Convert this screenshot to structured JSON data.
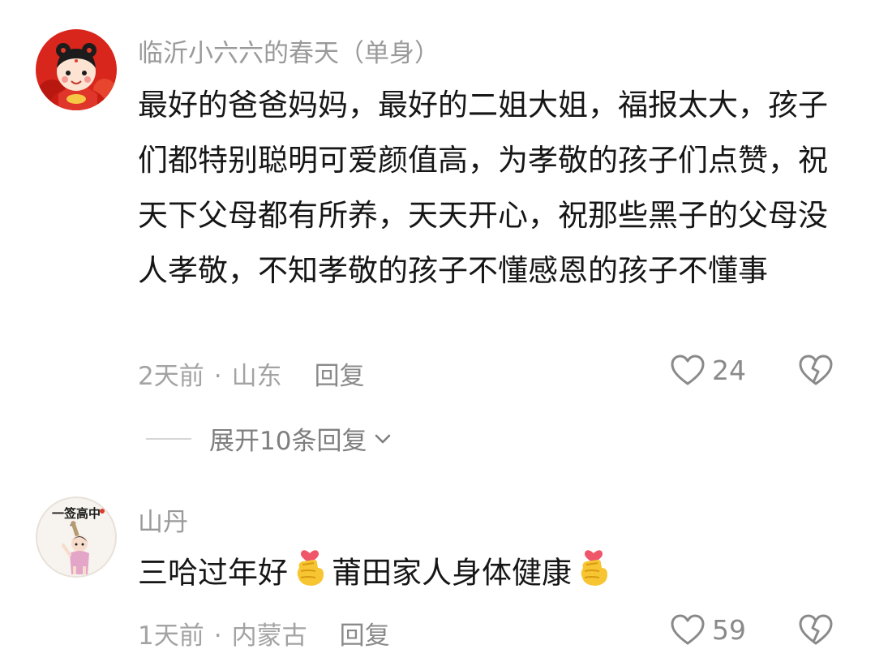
{
  "comments": [
    {
      "username": "临沂小六六的春天（单身）",
      "text": "最好的爸爸妈妈，最好的二姐大姐，福报太大，孩子们都特别聪明可爱颜值高，为孝敬的孩子们点赞，祝天下父母都有所养，天天开心，祝那些黑子的父母没人孝敬，不知孝敬的孩子不懂感恩的孩子不懂事",
      "time": "2天前",
      "location": "山东",
      "reply_label": "回复",
      "likes": "24",
      "avatar_icon": "festive-girl-avatar",
      "expand_label": "展开10条回复"
    },
    {
      "username": "山丹",
      "avatar_text": "一签高中",
      "text_part1": "三哈过年好",
      "text_part2": "莆田家人身体健康",
      "emoji_icon": "finger-heart-emoji",
      "time": "1天前",
      "location": "内蒙古",
      "reply_label": "回复",
      "likes": "59"
    }
  ],
  "icons": {
    "like": "heart-outline-icon",
    "dislike": "broken-heart-icon",
    "expand": "chevron-down-icon"
  },
  "colors": {
    "username": "#9a9a9a",
    "text": "#161616",
    "meta": "#a3a3a3",
    "icon": "#8a8a8a"
  }
}
